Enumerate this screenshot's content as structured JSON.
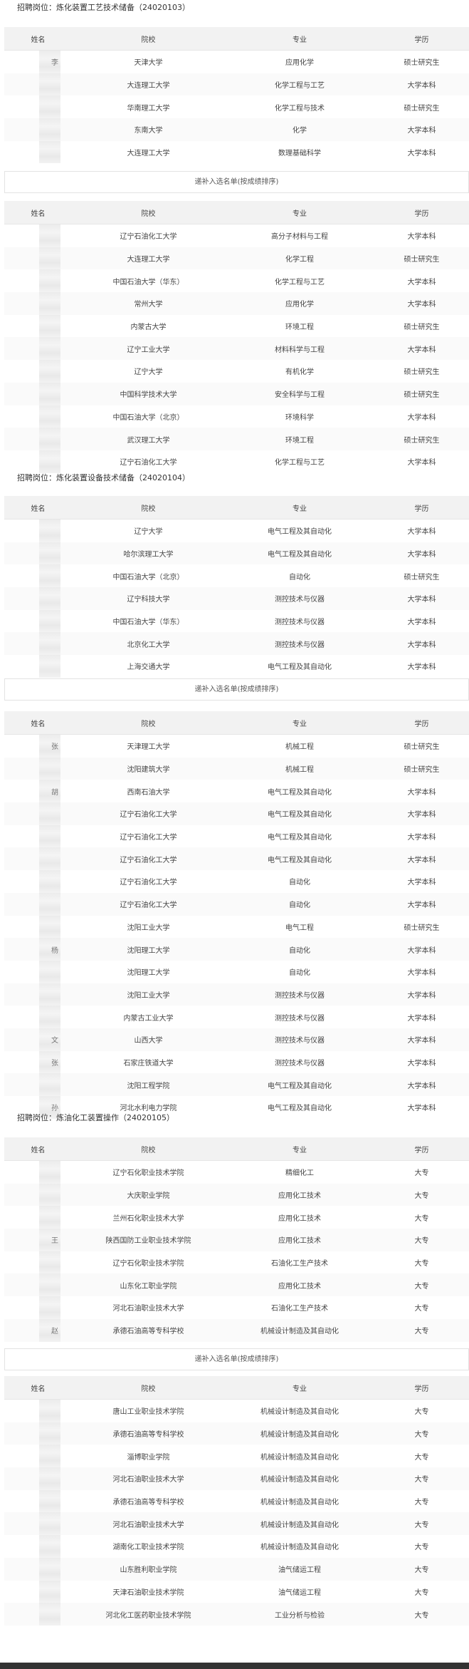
{
  "headers": {
    "name": "姓名",
    "school": "院校",
    "major": "专业",
    "degree": "学历"
  },
  "sections": [
    {
      "title": "招聘岗位：炼化装置工艺技术储备（24020103）",
      "blocks": [
        {
          "rows": [
            {
              "name": "李",
              "school": "天津大学",
              "major": "应用化学",
              "degree": "硕士研究生"
            },
            {
              "name": "",
              "school": "大连理工大学",
              "major": "化学工程与工艺",
              "degree": "大学本科"
            },
            {
              "name": "",
              "school": "华南理工大学",
              "major": "化学工程与技术",
              "degree": "硕士研究生"
            },
            {
              "name": "",
              "school": "东南大学",
              "major": "化学",
              "degree": "大学本科"
            },
            {
              "name": "",
              "school": "大连理工大学",
              "major": "数理基础科学",
              "degree": "大学本科"
            }
          ]
        },
        {
          "addon_label": "递补入选名单(按成绩排序)",
          "rows": [
            {
              "name": "",
              "school": "辽宁石油化工大学",
              "major": "高分子材料与工程",
              "degree": "大学本科"
            },
            {
              "name": "",
              "school": "大连理工大学",
              "major": "化学工程",
              "degree": "硕士研究生"
            },
            {
              "name": "",
              "school": "中国石油大学（华东）",
              "major": "化学工程与工艺",
              "degree": "大学本科"
            },
            {
              "name": "",
              "school": "常州大学",
              "major": "应用化学",
              "degree": "大学本科"
            },
            {
              "name": "",
              "school": "内蒙古大学",
              "major": "环境工程",
              "degree": "硕士研究生"
            },
            {
              "name": "",
              "school": "辽宁工业大学",
              "major": "材料科学与工程",
              "degree": "大学本科"
            },
            {
              "name": "",
              "school": "辽宁大学",
              "major": "有机化学",
              "degree": "硕士研究生"
            },
            {
              "name": "",
              "school": "中国科学技术大学",
              "major": "安全科学与工程",
              "degree": "硕士研究生"
            },
            {
              "name": "",
              "school": "中国石油大学（北京）",
              "major": "环境科学",
              "degree": "大学本科"
            },
            {
              "name": "",
              "school": "武汉理工大学",
              "major": "环境工程",
              "degree": "硕士研究生"
            },
            {
              "name": "",
              "school": "辽宁石油化工大学",
              "major": "化学工程与工艺",
              "degree": "大学本科"
            }
          ]
        }
      ]
    },
    {
      "title": "招聘岗位：炼化装置设备技术储备（24020104）",
      "blocks": [
        {
          "rows": [
            {
              "name": "",
              "school": "辽宁大学",
              "major": "电气工程及其自动化",
              "degree": "大学本科"
            },
            {
              "name": "",
              "school": "哈尔滨理工大学",
              "major": "电气工程及其自动化",
              "degree": "大学本科"
            },
            {
              "name": "",
              "school": "中国石油大学（北京）",
              "major": "自动化",
              "degree": "硕士研究生"
            },
            {
              "name": "",
              "school": "辽宁科技大学",
              "major": "测控技术与仪器",
              "degree": "大学本科"
            },
            {
              "name": "",
              "school": "中国石油大学（华东）",
              "major": "测控技术与仪器",
              "degree": "大学本科"
            },
            {
              "name": "",
              "school": "北京化工大学",
              "major": "测控技术与仪器",
              "degree": "大学本科"
            },
            {
              "name": "",
              "school": "上海交通大学",
              "major": "电气工程及其自动化",
              "degree": "大学本科"
            }
          ]
        },
        {
          "addon_label": "递补入选名单(按成绩排序)",
          "rows": [
            {
              "name": "张",
              "school": "天津理工大学",
              "major": "机械工程",
              "degree": "硕士研究生"
            },
            {
              "name": "",
              "school": "沈阳建筑大学",
              "major": "机械工程",
              "degree": "硕士研究生"
            },
            {
              "name": "胡",
              "school": "西南石油大学",
              "major": "电气工程及其自动化",
              "degree": "大学本科"
            },
            {
              "name": "",
              "school": "辽宁石油化工大学",
              "major": "电气工程及其自动化",
              "degree": "大学本科"
            },
            {
              "name": "",
              "school": "辽宁石油化工大学",
              "major": "电气工程及其自动化",
              "degree": "大学本科"
            },
            {
              "name": "",
              "school": "辽宁石油化工大学",
              "major": "电气工程及其自动化",
              "degree": "大学本科"
            },
            {
              "name": "",
              "school": "辽宁石油化工大学",
              "major": "自动化",
              "degree": "大学本科"
            },
            {
              "name": "",
              "school": "辽宁石油化工大学",
              "major": "自动化",
              "degree": "大学本科"
            },
            {
              "name": "",
              "school": "沈阳工业大学",
              "major": "电气工程",
              "degree": "硕士研究生"
            },
            {
              "name": "杨",
              "school": "沈阳理工大学",
              "major": "自动化",
              "degree": "大学本科"
            },
            {
              "name": "",
              "school": "沈阳理工大学",
              "major": "自动化",
              "degree": "大学本科"
            },
            {
              "name": "",
              "school": "沈阳工业大学",
              "major": "测控技术与仪器",
              "degree": "大学本科"
            },
            {
              "name": "",
              "school": "内蒙古工业大学",
              "major": "测控技术与仪器",
              "degree": "大学本科"
            },
            {
              "name": "文",
              "school": "山西大学",
              "major": "测控技术与仪器",
              "degree": "大学本科"
            },
            {
              "name": "张",
              "school": "石家庄铁道大学",
              "major": "测控技术与仪器",
              "degree": "大学本科"
            },
            {
              "name": "",
              "school": "沈阳工程学院",
              "major": "电气工程及其自动化",
              "degree": "大学本科"
            },
            {
              "name": "孙",
              "school": "河北水利电力学院",
              "major": "电气工程及其自动化",
              "degree": "大学本科"
            }
          ]
        }
      ]
    },
    {
      "title": "招聘岗位：炼油化工装置操作（24020105）",
      "blocks": [
        {
          "rows": [
            {
              "name": "",
              "school": "辽宁石化职业技术学院",
              "major": "精细化工",
              "degree": "大专"
            },
            {
              "name": "",
              "school": "大庆职业学院",
              "major": "应用化工技术",
              "degree": "大专"
            },
            {
              "name": "",
              "school": "兰州石化职业技术大学",
              "major": "应用化工技术",
              "degree": "大专"
            },
            {
              "name": "王",
              "school": "陕西国防工业职业技术学院",
              "major": "应用化工技术",
              "degree": "大专"
            },
            {
              "name": "",
              "school": "辽宁石化职业技术学院",
              "major": "石油化工生产技术",
              "degree": "大专"
            },
            {
              "name": "",
              "school": "山东化工职业学院",
              "major": "应用化工技术",
              "degree": "大专"
            },
            {
              "name": "",
              "school": "河北石油职业技术大学",
              "major": "石油化工生产技术",
              "degree": "大专"
            },
            {
              "name": "赵",
              "school": "承德石油高等专科学校",
              "major": "机械设计制造及其自动化",
              "degree": "大专"
            }
          ]
        },
        {
          "addon_label": "递补入选名单(按成绩排序)",
          "rows": [
            {
              "name": "",
              "school": "唐山工业职业技术学院",
              "major": "机械设计制造及其自动化",
              "degree": "大专"
            },
            {
              "name": "",
              "school": "承德石油高等专科学校",
              "major": "机械设计制造及其自动化",
              "degree": "大专"
            },
            {
              "name": "",
              "school": "淄博职业学院",
              "major": "机械设计制造及其自动化",
              "degree": "大专"
            },
            {
              "name": "",
              "school": "河北石油职业技术大学",
              "major": "机械设计制造及其自动化",
              "degree": "大专"
            },
            {
              "name": "",
              "school": "承德石油高等专科学校",
              "major": "机械设计制造及其自动化",
              "degree": "大专"
            },
            {
              "name": "",
              "school": "河北石油职业技术大学",
              "major": "机械设计制造及其自动化",
              "degree": "大专"
            },
            {
              "name": "",
              "school": "湖南化工职业技术学院",
              "major": "机械设计制造及其自动化",
              "degree": "大专"
            },
            {
              "name": "",
              "school": "山东胜利职业学院",
              "major": "油气储运工程",
              "degree": "大专"
            },
            {
              "name": "",
              "school": "天津石油职业技术学院",
              "major": "油气储运工程",
              "degree": "大专"
            },
            {
              "name": "",
              "school": "河北化工医药职业技术学院",
              "major": "工业分析与检验",
              "degree": "大专"
            }
          ]
        }
      ]
    }
  ]
}
